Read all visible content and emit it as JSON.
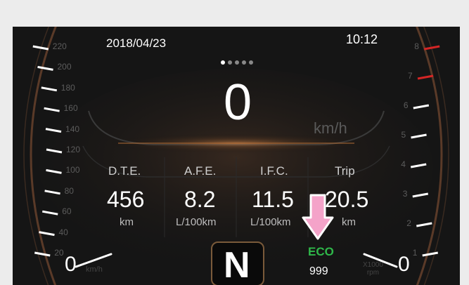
{
  "status_bar": {
    "date": "2018/04/23",
    "time": "10:12"
  },
  "pager": {
    "page_count": 5,
    "active_index": 0
  },
  "speedometer": {
    "speed": "0",
    "unit": "km/h",
    "zero_label": "0",
    "small_unit": "km/h",
    "scale_labels": [
      "220",
      "200",
      "180",
      "160",
      "140",
      "120",
      "100",
      "80",
      "60",
      "40",
      "20"
    ]
  },
  "tachometer": {
    "zero_label": "0",
    "unit_line1": "X1000",
    "unit_line2": "rpm",
    "scale_labels": [
      "8",
      "7",
      "6",
      "5",
      "4",
      "3",
      "2",
      "1"
    ],
    "redline_from": 6.2
  },
  "trip_info": [
    {
      "label": "D.T.E.",
      "value": "456",
      "unit": "km"
    },
    {
      "label": "A.F.E.",
      "value": "8.2",
      "unit": "L/100km"
    },
    {
      "label": "I.F.C.",
      "value": "11.5",
      "unit": "L/100km"
    },
    {
      "label": "Trip",
      "value": "20.5",
      "unit": "km"
    }
  ],
  "gear": {
    "position": "N"
  },
  "eco": {
    "label": "ECO",
    "value": "999"
  },
  "colors": {
    "eco_green": "#2fb84a",
    "redline": "#d42525",
    "arrow_pink": "#f4a3c9",
    "glow_orange": "#c8793a"
  },
  "icons": {
    "pointer": "down-arrow-icon"
  }
}
